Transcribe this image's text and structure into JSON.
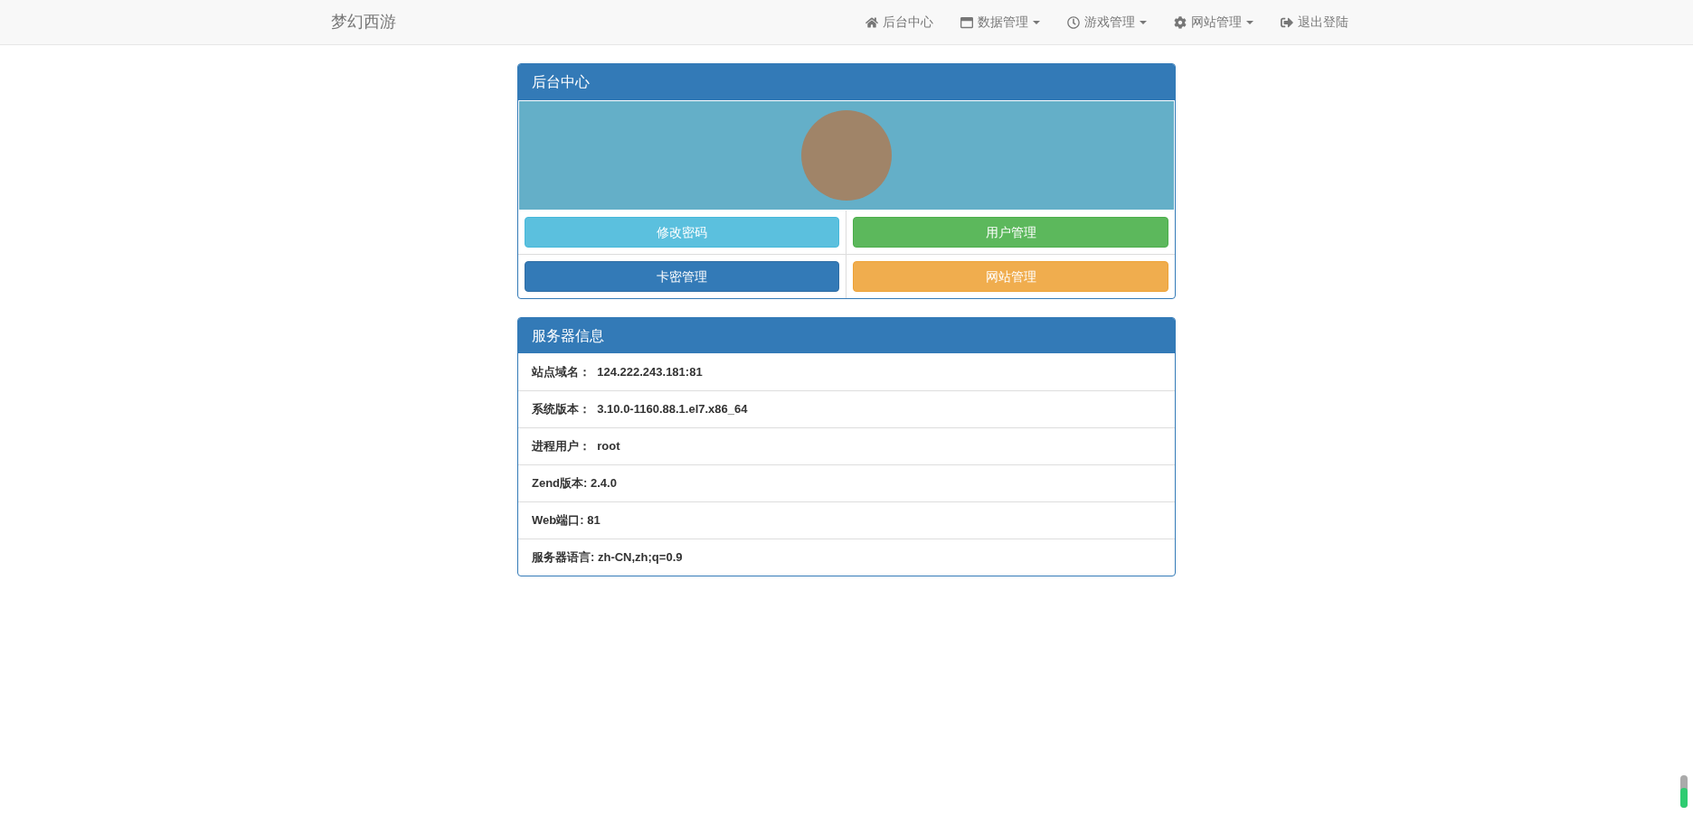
{
  "navbar": {
    "brand": "梦幻西游",
    "items": [
      {
        "label": "后台中心",
        "dropdown": false
      },
      {
        "label": "数据管理",
        "dropdown": true
      },
      {
        "label": "游戏管理",
        "dropdown": true
      },
      {
        "label": "网站管理",
        "dropdown": true
      },
      {
        "label": "退出登陆",
        "dropdown": false
      }
    ]
  },
  "admin_panel": {
    "title": "后台中心",
    "buttons": [
      {
        "label": "修改密码",
        "kind": "info"
      },
      {
        "label": "用户管理",
        "kind": "success"
      },
      {
        "label": "卡密管理",
        "kind": "primary"
      },
      {
        "label": "网站管理",
        "kind": "warning"
      }
    ]
  },
  "server_panel": {
    "title": "服务器信息",
    "rows": [
      "站点域名：  124.222.243.181:81",
      "系统版本：  3.10.0-1160.88.1.el7.x86_64",
      "进程用户：  root",
      "Zend版本: 2.4.0",
      "Web端口: 81",
      "服务器语言: zh-CN,zh;q=0.9"
    ]
  }
}
